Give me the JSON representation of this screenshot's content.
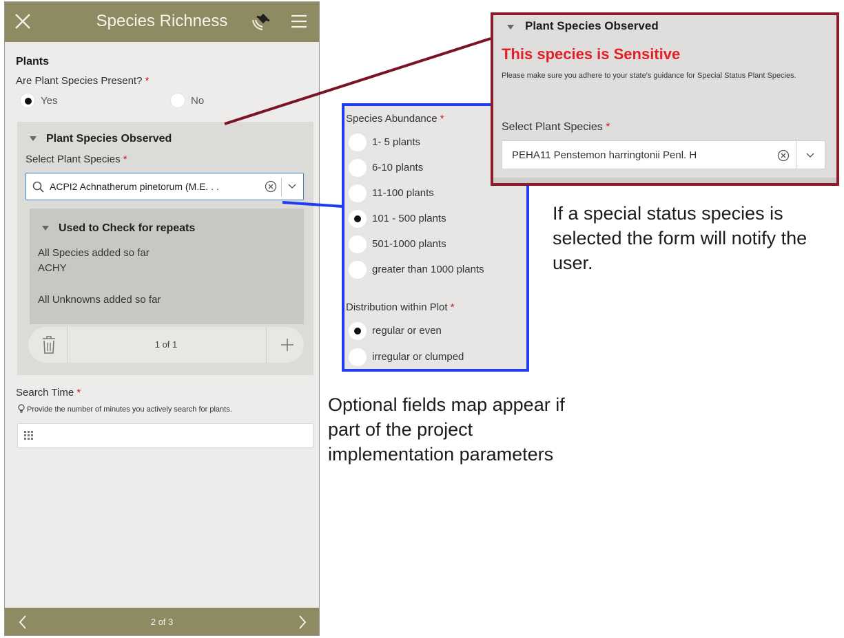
{
  "header": {
    "title": "Species Richness",
    "icons": [
      "close-icon",
      "gps-icon",
      "menu-icon"
    ]
  },
  "form": {
    "section_title": "Plants",
    "present_question": "Are Plant Species Present?",
    "required_mark": "*",
    "present_options": [
      {
        "label": "Yes",
        "selected": true
      },
      {
        "label": "No",
        "selected": false
      }
    ],
    "group_title": "Plant Species Observed",
    "select_label": "Select Plant Species",
    "select_value": "ACPI2   Achnatherum pinetorum (M.E. . .",
    "repeat_group_title": "Used to Check for repeats",
    "species_added_label": "All Species added so far",
    "species_added_value": "ACHY",
    "unknowns_added_label": "All Unknowns added so far",
    "repeat_counter": "1 of 1",
    "search_time_label": "Search Time",
    "search_time_hint": "Provide the number of minutes you actively search for plants.",
    "search_time_value": ""
  },
  "footer": {
    "page_indicator": "2 of 3"
  },
  "optional_panel": {
    "abundance_label": "Species Abundance",
    "abundance_options": [
      {
        "label": "1- 5 plants",
        "selected": false
      },
      {
        "label": "6-10 plants",
        "selected": false
      },
      {
        "label": "11-100 plants",
        "selected": false
      },
      {
        "label": "101 - 500 plants",
        "selected": true
      },
      {
        "label": "501-1000 plants",
        "selected": false
      },
      {
        "label": "greater than 1000 plants",
        "selected": false
      }
    ],
    "distribution_label": "Distribution within Plot",
    "distribution_options": [
      {
        "label": "regular or even",
        "selected": true
      },
      {
        "label": "irregular or clumped",
        "selected": false
      }
    ]
  },
  "sensitive_panel": {
    "group_title": "Plant Species Observed",
    "warning": "This species is Sensitive",
    "note": "Please make sure you adhere to your state's guidance for Special Status Plant Species.",
    "select_label": "Select Plant Species",
    "select_value": "PEHA11   Penstemon harringtonii Penl.   H"
  },
  "annotations": {
    "right": "If a special status species is selected the form will notify the user.",
    "left": "Optional fields map appear if part of the project implementation parameters"
  },
  "colors": {
    "header_bar": "#8e8b63",
    "required": "#c8202a",
    "optional_border": "#1e3cf0",
    "sensitive_border": "#8a1c2b",
    "sensitive_text": "#e02028"
  }
}
